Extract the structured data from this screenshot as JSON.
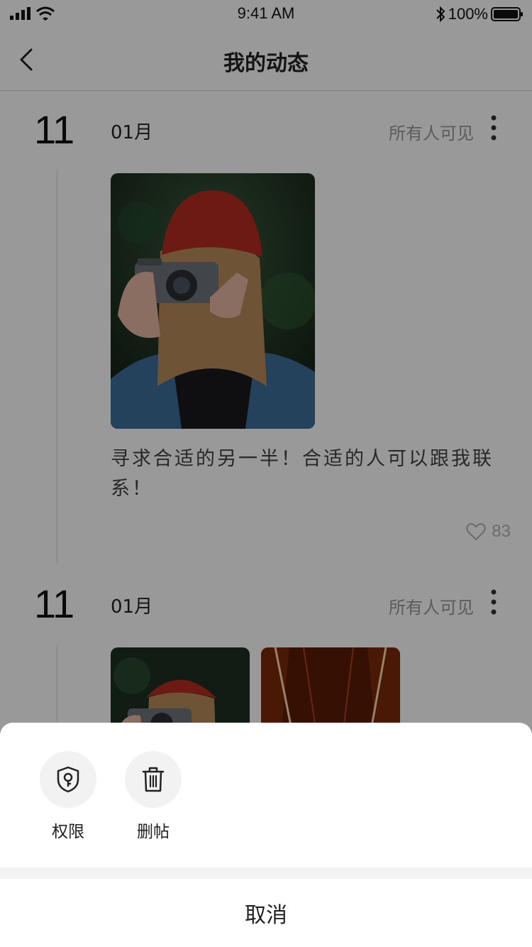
{
  "status_bar": {
    "time": "9:41 AM",
    "battery": "100%"
  },
  "nav": {
    "title": "我的动态"
  },
  "posts": [
    {
      "day": "11",
      "month": "01月",
      "visibility": "所有人可见",
      "text": "寻求合适的另一半！合适的人可以跟我联系！",
      "likes": "83"
    },
    {
      "day": "11",
      "month": "01月",
      "visibility": "所有人可见"
    }
  ],
  "sheet": {
    "options": [
      {
        "label": "权限",
        "icon": "shield-key-icon"
      },
      {
        "label": "删帖",
        "icon": "trash-icon"
      }
    ],
    "cancel": "取消"
  }
}
